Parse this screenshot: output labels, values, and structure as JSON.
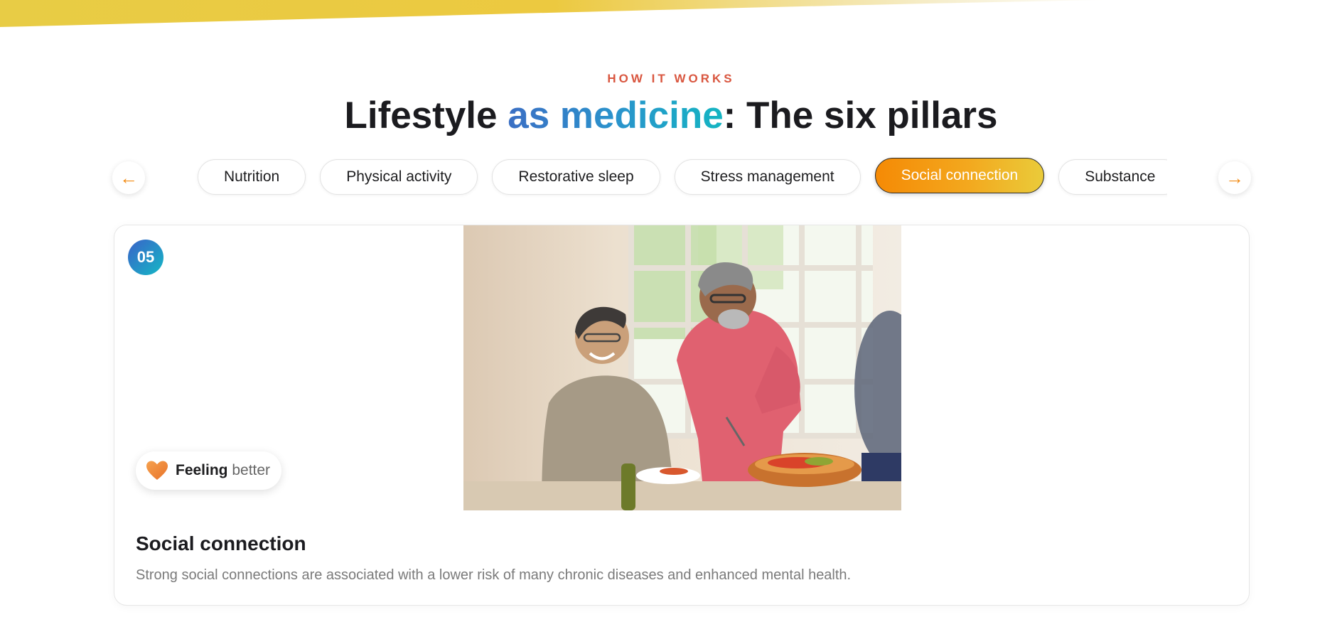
{
  "section": {
    "eyebrow": "HOW IT WORKS",
    "heading_pre": "Lifestyle ",
    "heading_highlight": "as medicine",
    "heading_post": ": The six pillars"
  },
  "nav": {
    "prev_icon": "←",
    "next_icon": "→"
  },
  "tabs": [
    {
      "label": "Nutrition"
    },
    {
      "label": "Physical activity"
    },
    {
      "label": "Restorative sleep"
    },
    {
      "label": "Stress management"
    },
    {
      "label": "Social connection",
      "active": true
    },
    {
      "label": "Substance"
    }
  ],
  "card": {
    "number": "05",
    "badge_strong": "Feeling",
    "badge_light": " better",
    "badge_icon": "heart-icon",
    "title": "Social connection",
    "description": "Strong social connections are associated with a lower risk of many chronic diseases and enhanced mental health."
  },
  "colors": {
    "accent_orange": "#f58a05",
    "accent_yellow": "#eacb3a",
    "eyebrow": "#d9563f",
    "gradient_blue": "#3b6fc4",
    "gradient_teal": "#14b5c2"
  }
}
